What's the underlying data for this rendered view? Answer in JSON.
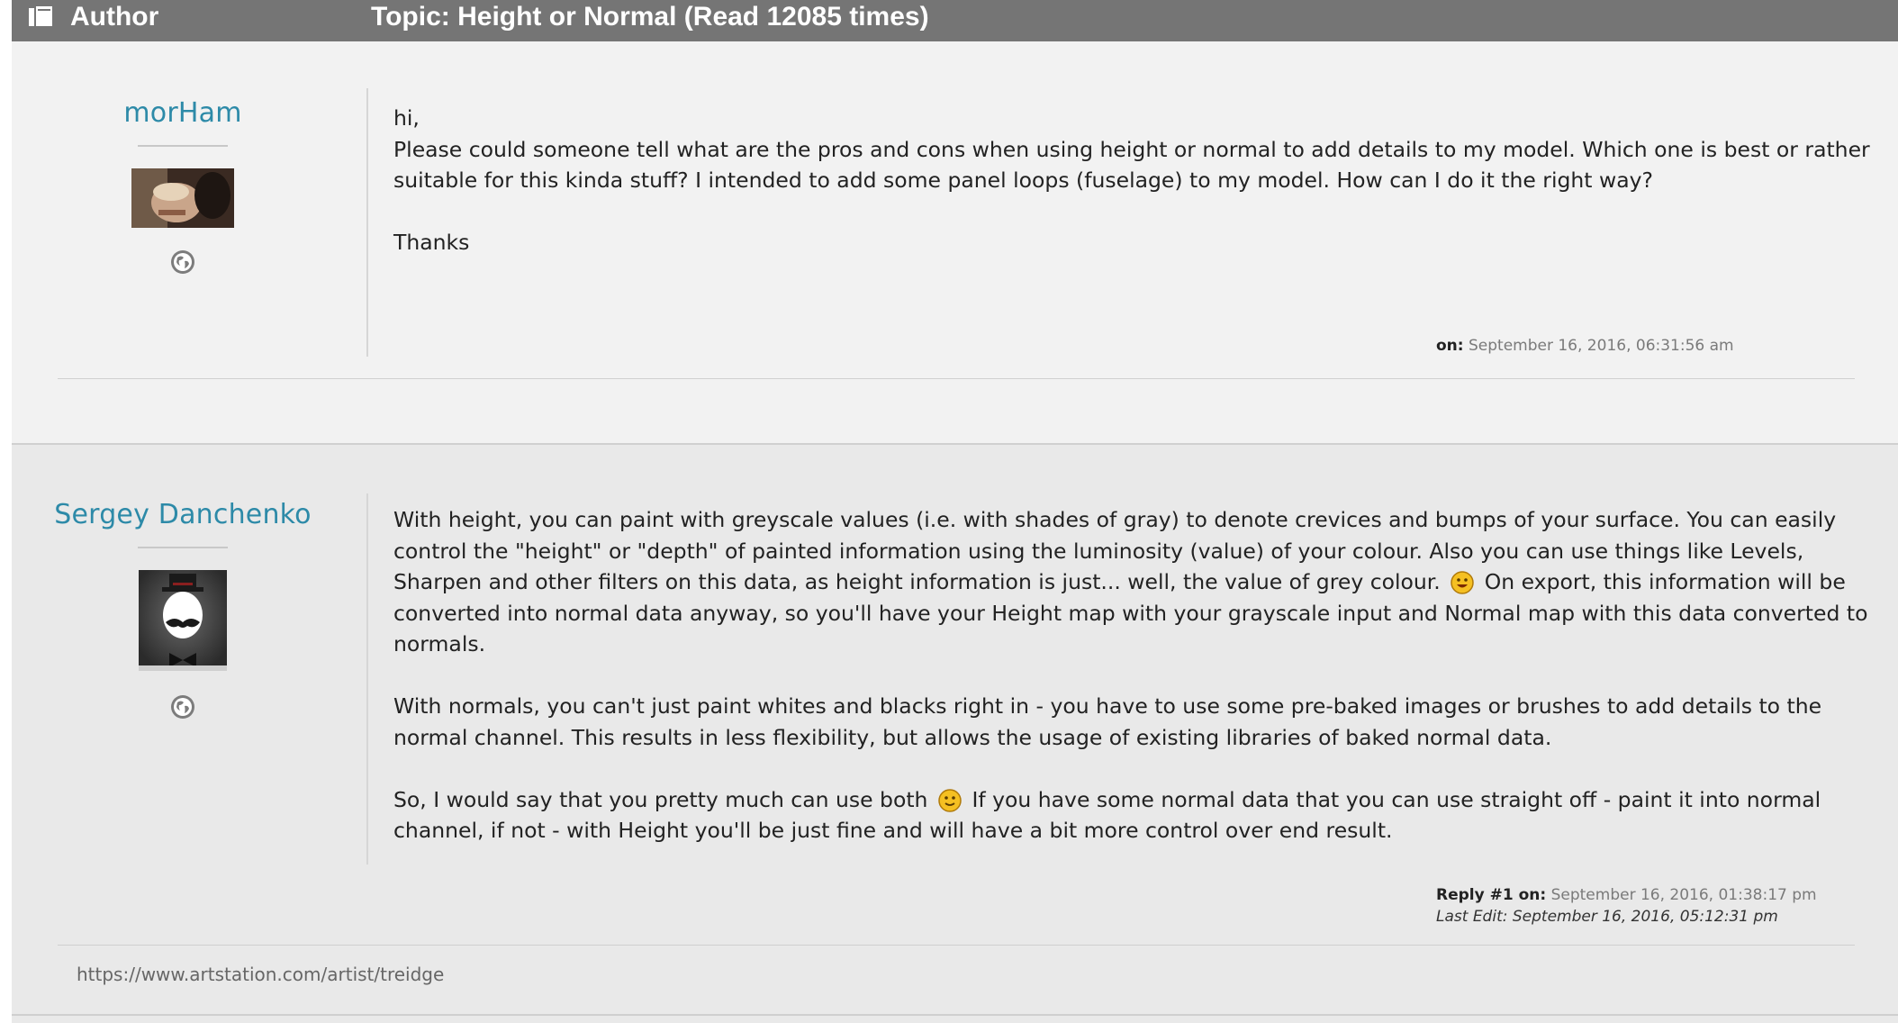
{
  "header": {
    "author_label": "Author",
    "topic_title": "Topic: Height or Normal  (Read 12085 times)"
  },
  "posts": [
    {
      "author": "morHam",
      "paragraphs": [
        "hi,",
        "Please could someone tell what are the pros and cons when using height or normal to add details to my model. Which one is best or rather suitable for this kinda stuff? I intended to add some panel loops (fuselage) to my model. How can I do it the right way?",
        "Thanks"
      ],
      "meta_prefix": "on:",
      "meta_date": "September 16, 2016, 06:31:56 am"
    },
    {
      "author": "Sergey Danchenko",
      "p1_a": "With height, you can paint with greyscale values (i.e. with shades of gray) to denote crevices and bumps of your surface. You can easily control the \"height\" or \"depth\" of painted information using the luminosity (value) of your colour. Also you can use things like Levels, Sharpen and other filters on this data, as height information is just... well, the value of grey colour.",
      "p1_b": "On export, this information will be converted into normal data anyway, so you'll have your Height map with your grayscale input and Normal map with this data converted to normals.",
      "p2": "With normals, you can't just paint whites and blacks right in - you have to use some pre-baked images or brushes to add details to the normal channel. This results in less flexibility, but allows the usage of existing libraries of baked normal data.",
      "p3_a": "So, I would say that you pretty much can use both",
      "p3_b": "If you have some normal data that you can use straight off - paint it into normal channel, if not - with Height you'll be just fine and will have a bit more control over end result.",
      "meta_prefix": "Reply #1 on:",
      "meta_date": "September 16, 2016, 01:38:17 pm",
      "last_edit": "Last Edit: September 16, 2016, 05:12:31 pm",
      "signature": "https://www.artstation.com/artist/treidge"
    }
  ],
  "icons": {
    "header": "book-icon",
    "profile": "globe-icon",
    "emoji": "smiley-icon"
  },
  "colors": {
    "header_bg": "#757575",
    "username": "#2d8aa8"
  }
}
